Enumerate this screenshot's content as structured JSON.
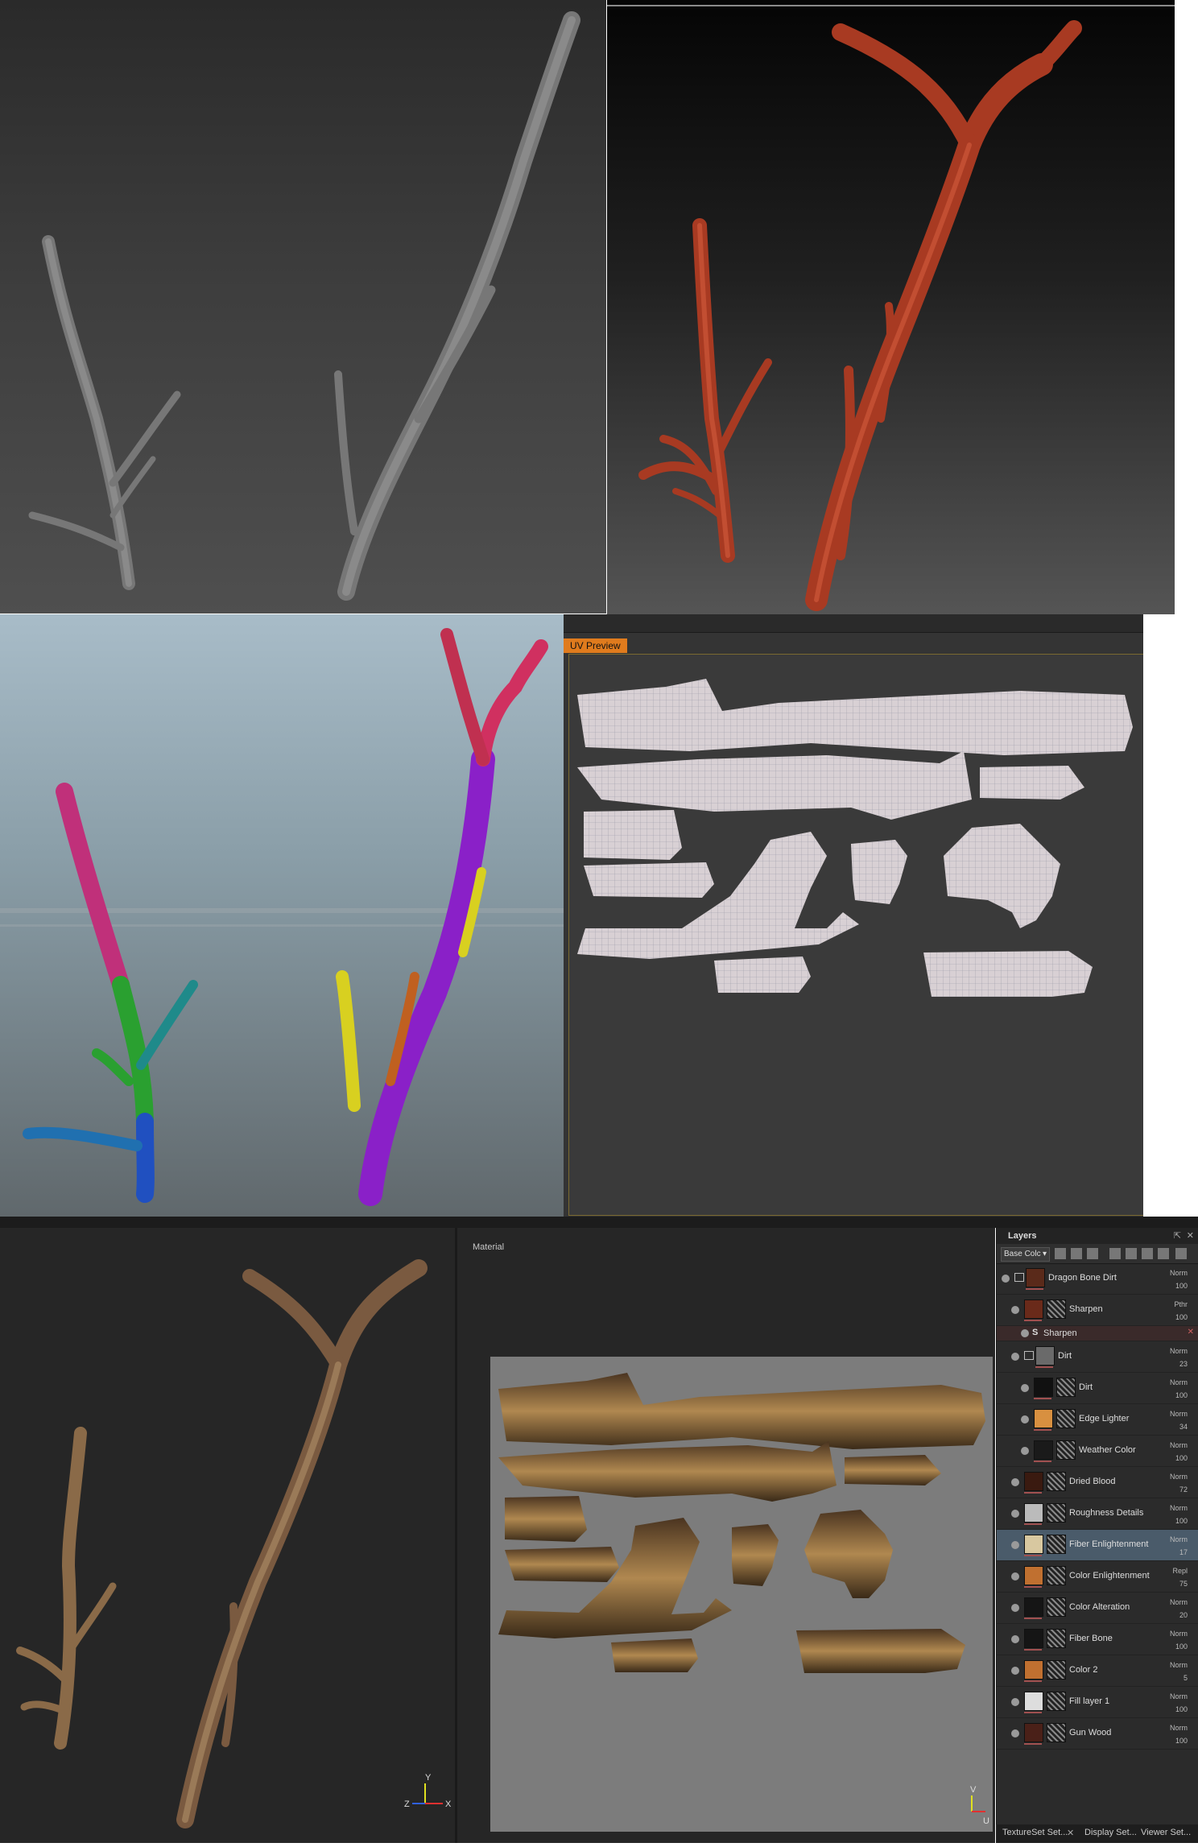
{
  "uv_panel": {
    "tab_label": "UV Preview"
  },
  "viewport_2d": {
    "label": "Material"
  },
  "layers_panel": {
    "title": "Layers",
    "channel_dropdown": "Base Colc",
    "layers": [
      {
        "name": "Dragon Bone Dirt",
        "blend": "Norm",
        "opacity": "100",
        "thumb_color": "#5a2a1a",
        "indent": 0,
        "folder": true
      },
      {
        "name": "Sharpen",
        "blend": "Pthr",
        "opacity": "100",
        "thumb_color": "#6a2a1a",
        "indent": 1
      },
      {
        "name": "Sharpen",
        "blend": "",
        "opacity": "",
        "thumb_color": "",
        "indent": 2,
        "effect": true
      },
      {
        "name": "Dirt",
        "blend": "Norm",
        "opacity": "23",
        "thumb_color": "#6a6a6a",
        "indent": 1,
        "folder": true
      },
      {
        "name": "Dirt",
        "blend": "Norm",
        "opacity": "100",
        "thumb_color": "#111111",
        "indent": 2
      },
      {
        "name": "Edge Lighter",
        "blend": "Norm",
        "opacity": "34",
        "thumb_color": "#d89040",
        "indent": 2
      },
      {
        "name": "Weather Color",
        "blend": "Norm",
        "opacity": "100",
        "thumb_color": "#1a1a1a",
        "indent": 2
      },
      {
        "name": "Dried Blood",
        "blend": "Norm",
        "opacity": "72",
        "thumb_color": "#3a1a10",
        "indent": 1
      },
      {
        "name": "Roughness Details",
        "blend": "Norm",
        "opacity": "100",
        "thumb_color": "#bbbbbb",
        "indent": 1
      },
      {
        "name": "Fiber Enlightenment",
        "blend": "Norm",
        "opacity": "17",
        "thumb_color": "#d8c8a0",
        "indent": 1,
        "selected": true
      },
      {
        "name": "Color Enlightenment",
        "blend": "Repl",
        "opacity": "75",
        "thumb_color": "#c07030",
        "indent": 1
      },
      {
        "name": "Color Alteration",
        "blend": "Norm",
        "opacity": "20",
        "thumb_color": "#151515",
        "indent": 1
      },
      {
        "name": "Fiber Bone",
        "blend": "Norm",
        "opacity": "100",
        "thumb_color": "#151515",
        "indent": 1
      },
      {
        "name": "Color 2",
        "blend": "Norm",
        "opacity": "5",
        "thumb_color": "#c07030",
        "indent": 1
      },
      {
        "name": "Fill layer 1",
        "blend": "Norm",
        "opacity": "100",
        "thumb_color": "#dddddd",
        "indent": 1
      },
      {
        "name": "Gun Wood",
        "blend": "Norm",
        "opacity": "100",
        "thumb_color": "#4a2018",
        "indent": 1
      }
    ]
  },
  "bottom_tabs": [
    "TextureSet Set...",
    "Display Set...",
    "Viewer Set..."
  ],
  "axes": {
    "x": "X",
    "y": "Y",
    "z": "Z",
    "u": "U",
    "v": "V"
  }
}
